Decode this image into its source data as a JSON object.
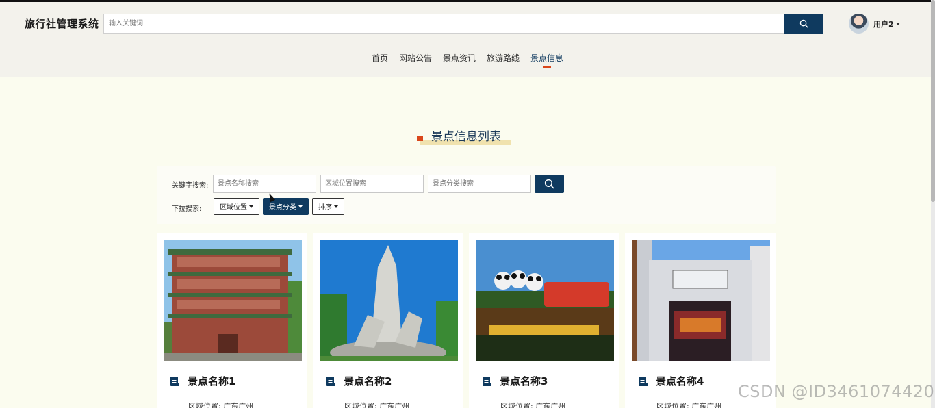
{
  "header": {
    "brand": "旅行社管理系统",
    "search_placeholder": "输入关键词",
    "user_name": "用户2"
  },
  "nav": {
    "items": [
      {
        "label": "首页",
        "active": false
      },
      {
        "label": "网站公告",
        "active": false
      },
      {
        "label": "景点资讯",
        "active": false
      },
      {
        "label": "旅游路线",
        "active": false
      },
      {
        "label": "景点信息",
        "active": true
      }
    ]
  },
  "section": {
    "title": "景点信息列表"
  },
  "filters": {
    "keyword_label": "关键字搜索:",
    "dropdown_label": "下拉搜索:",
    "name_placeholder": "景点名称搜索",
    "region_placeholder": "区域位置搜索",
    "category_placeholder": "景点分类搜索",
    "dd_region": "区域位置",
    "dd_category": "景点分类",
    "dd_sort": "排序"
  },
  "cards": [
    {
      "name": "景点名称1",
      "region": "区域位置: 广东广州"
    },
    {
      "name": "景点名称2",
      "region": "区域位置: 广东广州"
    },
    {
      "name": "景点名称3",
      "region": "区域位置: 广东广州"
    },
    {
      "name": "景点名称4",
      "region": "区域位置: 广东广州"
    }
  ],
  "watermark": "CSDN @ID3461074420",
  "colors": {
    "primary": "#0f3a5f",
    "accent": "#d9471b",
    "background": "#fbfcef",
    "header_bg": "#f3f2ec"
  }
}
